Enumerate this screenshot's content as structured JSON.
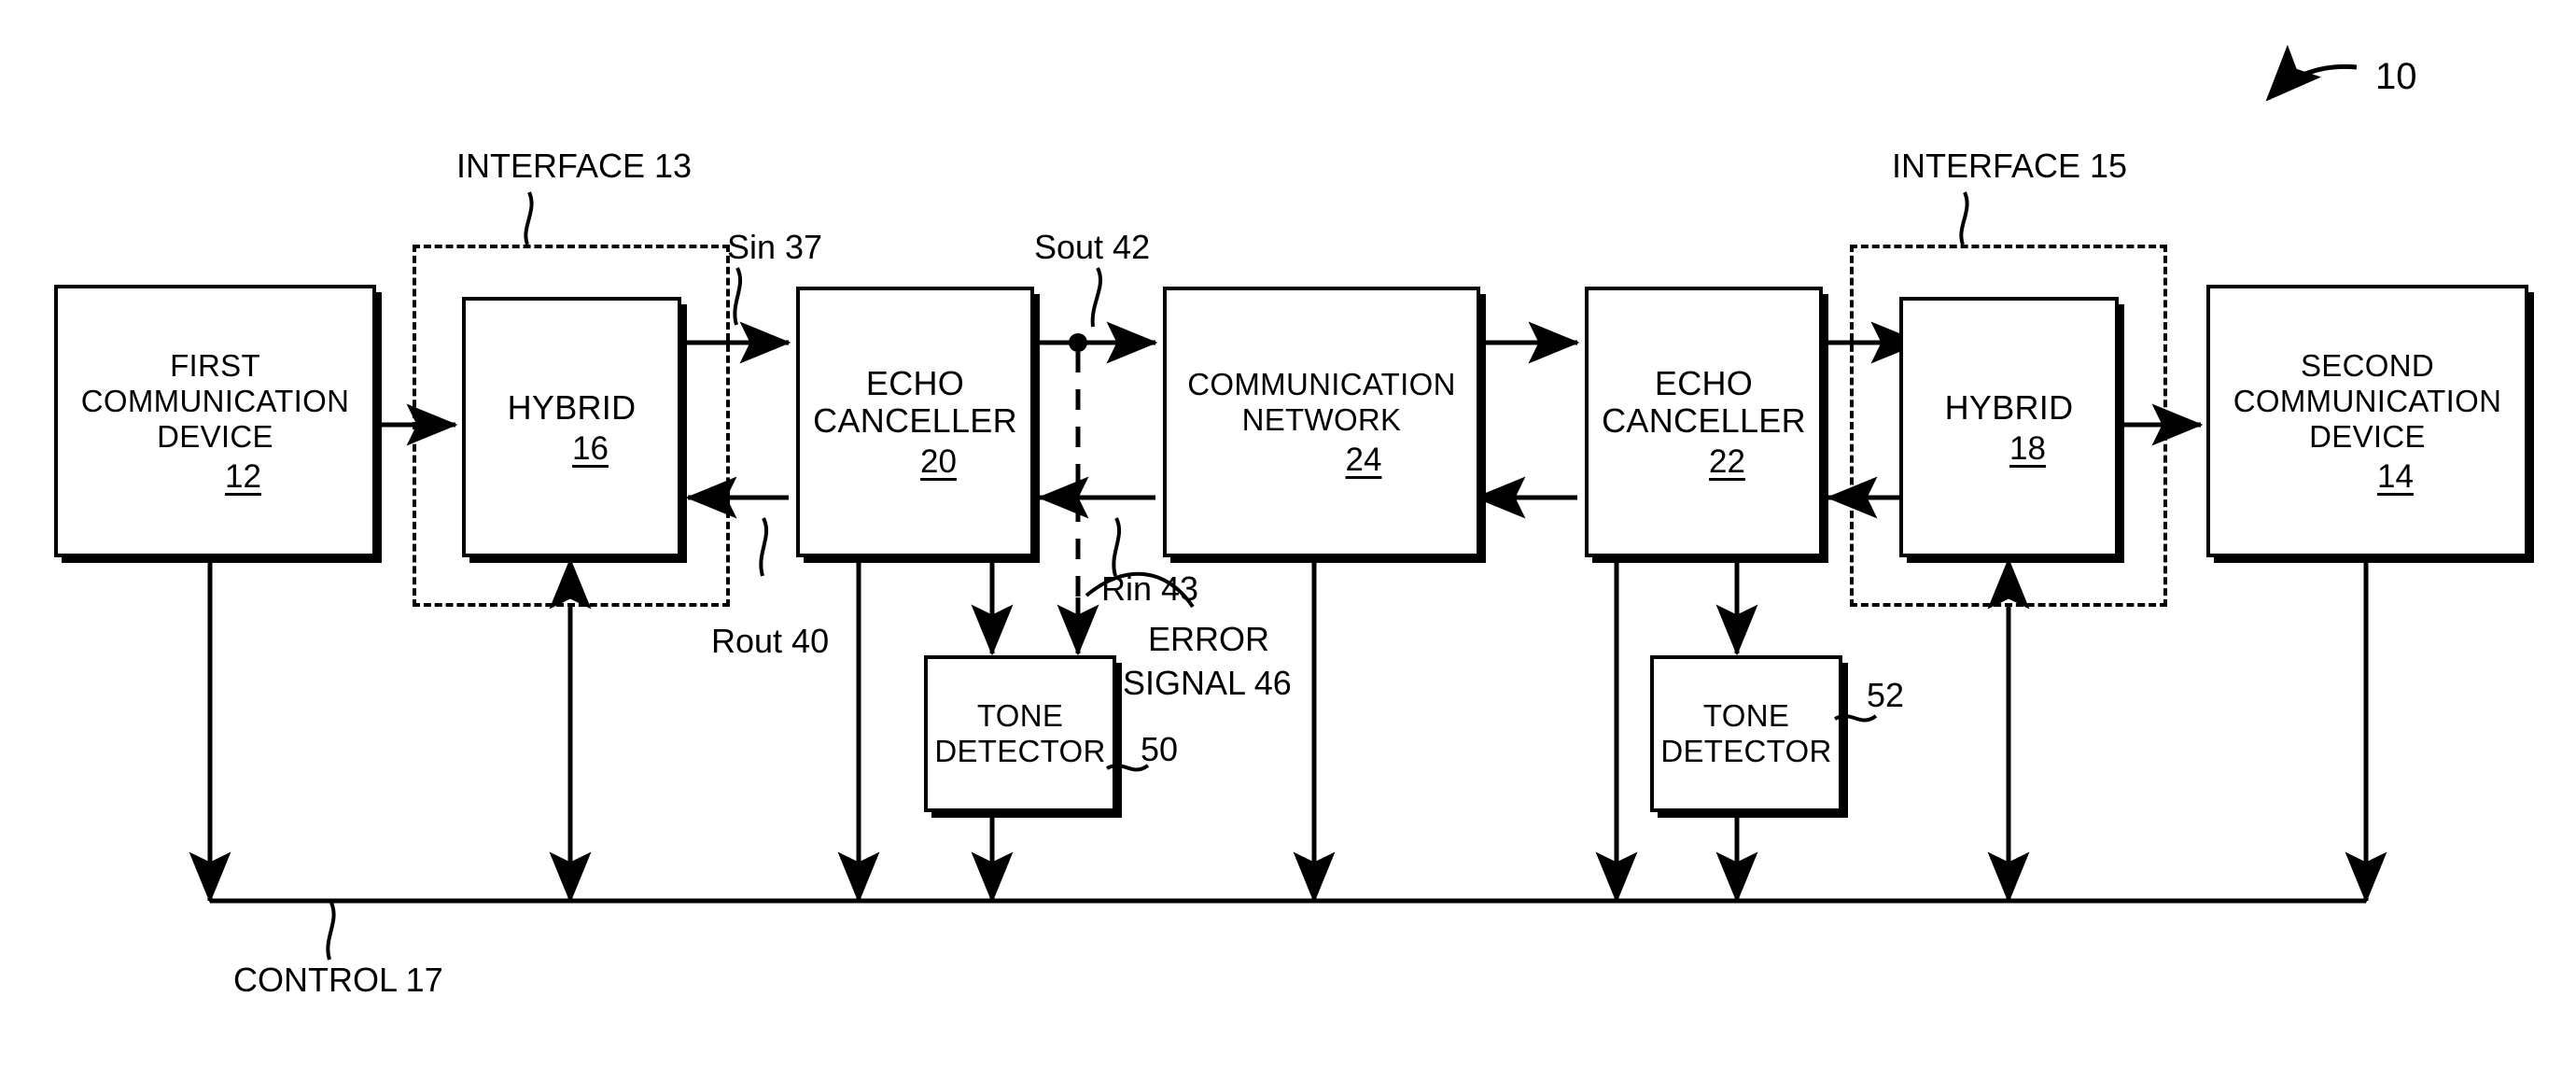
{
  "figure": {
    "figure_ref": "10",
    "boxes": [
      {
        "id": "first-communication-device",
        "lines": [
          "FIRST",
          "COMMUNICATION",
          "DEVICE"
        ],
        "ref": "12"
      },
      {
        "id": "hybrid-16",
        "lines": [
          "HYBRID"
        ],
        "ref": "16"
      },
      {
        "id": "echo-canceller-20",
        "lines": [
          "ECHO",
          "CANCELLER"
        ],
        "ref": "20"
      },
      {
        "id": "communication-network-24",
        "lines": [
          "COMMUNICATION",
          "NETWORK"
        ],
        "ref": "24"
      },
      {
        "id": "echo-canceller-22",
        "lines": [
          "ECHO",
          "CANCELLER"
        ],
        "ref": "22"
      },
      {
        "id": "hybrid-18",
        "lines": [
          "HYBRID"
        ],
        "ref": "18"
      },
      {
        "id": "second-communication-device",
        "lines": [
          "SECOND",
          "COMMUNICATION",
          "DEVICE"
        ],
        "ref": "14"
      },
      {
        "id": "tone-detector-50",
        "lines": [
          "TONE",
          "DETECTOR"
        ],
        "ref": ""
      },
      {
        "id": "tone-detector-52",
        "lines": [
          "TONE",
          "DETECTOR"
        ],
        "ref": ""
      }
    ],
    "labels": {
      "interface_13": "INTERFACE 13",
      "interface_15": "INTERFACE 15",
      "sin_37": "Sin 37",
      "sout_42": "Sout 42",
      "rout_40": "Rout 40",
      "rin_43": "Rin 43",
      "error_signal_46_line1": "ERROR",
      "error_signal_46_line2": "SIGNAL 46",
      "tone_detector_50_ref": "50",
      "tone_detector_52_ref": "52",
      "control_17": "CONTROL 17"
    },
    "colors": {
      "stroke": "#000000",
      "background": "#ffffff"
    }
  }
}
